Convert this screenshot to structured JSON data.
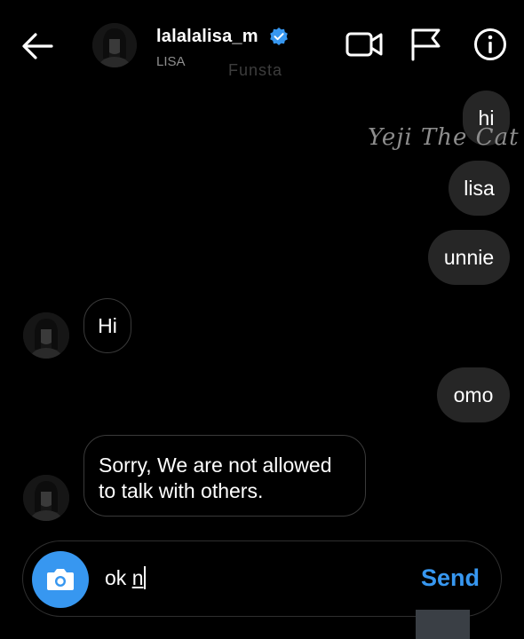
{
  "header": {
    "username": "lalalalisa_m",
    "display_name": "LISA",
    "overlay_text": "Funsta",
    "icons": [
      "back-arrow-icon",
      "verified-badge-icon",
      "video-call-icon",
      "flag-icon",
      "info-icon"
    ]
  },
  "watermark": "Yeji The Cat",
  "messages": [
    {
      "direction": "outgoing",
      "text": "hi"
    },
    {
      "direction": "outgoing",
      "text": "lisa"
    },
    {
      "direction": "outgoing",
      "text": "unnie"
    },
    {
      "direction": "incoming",
      "text": "Hi"
    },
    {
      "direction": "outgoing",
      "text": "omo"
    },
    {
      "direction": "incoming",
      "text": "Sorry, We are not allowed to talk with others."
    }
  ],
  "composer": {
    "typed_prefix": "ok ",
    "typed_underlined": "n",
    "send_label": "Send"
  },
  "colors": {
    "background": "#000000",
    "outgoing_bubble": "#262626",
    "accent": "#3797f0",
    "verified": "#3797f0"
  }
}
